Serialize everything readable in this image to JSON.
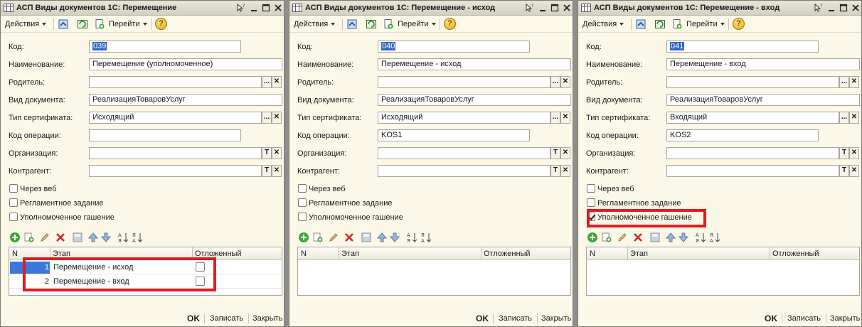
{
  "windows": [
    {
      "title": "АСП Виды документов 1С: Перемещение",
      "toolbar": {
        "actions": "Действия",
        "goto": "Перейти",
        "help": "?"
      },
      "fields": {
        "code_label": "Код:",
        "code_value": "039",
        "name_label": "Наименование:",
        "name_value": "Перемещение (уполномоченное)",
        "parent_label": "Родитель:",
        "parent_value": "",
        "doc_type_label": "Вид документа:",
        "doc_type_value": "РеализацияТоваровУслуг",
        "cert_type_label": "Тип сертификата:",
        "cert_type_value": "Исходящий",
        "op_code_label": "Код операции:",
        "op_code_value": "",
        "org_label": "Организация:",
        "org_value": "",
        "contractor_label": "Контрагент:",
        "contractor_value": ""
      },
      "checkboxes": [
        {
          "label": "Через веб",
          "checked": false
        },
        {
          "label": "Регламентное задание",
          "checked": false
        },
        {
          "label": "Уполномоченное гашение",
          "checked": false
        }
      ],
      "grid": {
        "columns": [
          "N",
          "Этап",
          "Отложенный"
        ],
        "rows": [
          {
            "n": "1",
            "stage": "Перемещение - исход",
            "deferred": false
          },
          {
            "n": "2",
            "stage": "Перемещение - вход",
            "deferred": false
          }
        ]
      },
      "footer": {
        "ok": "OK",
        "save": "Записать",
        "close": "Закрыть"
      }
    },
    {
      "title": "АСП Виды документов 1С: Перемещение - исход",
      "toolbar": {
        "actions": "Действия",
        "goto": "Перейти",
        "help": "?"
      },
      "fields": {
        "code_label": "Код:",
        "code_value": "040",
        "name_label": "Наименование:",
        "name_value": "Перемещение - исход",
        "parent_label": "Родитель:",
        "parent_value": "",
        "doc_type_label": "Вид документа:",
        "doc_type_value": "РеализацияТоваровУслуг",
        "cert_type_label": "Тип сертификата:",
        "cert_type_value": "Исходящий",
        "op_code_label": "Код операции:",
        "op_code_value": "KOS1",
        "org_label": "Организация:",
        "org_value": "",
        "contractor_label": "Контрагент:",
        "contractor_value": ""
      },
      "checkboxes": [
        {
          "label": "Через веб",
          "checked": false
        },
        {
          "label": "Регламентное задание",
          "checked": false
        },
        {
          "label": "Уполномоченное гашение",
          "checked": false
        }
      ],
      "grid": {
        "columns": [
          "N",
          "Этап",
          "Отложенный"
        ],
        "rows": []
      },
      "footer": {
        "ok": "OK",
        "save": "Записать",
        "close": "Закрыть"
      }
    },
    {
      "title": "АСП Виды документов 1С: Перемещение - вход",
      "toolbar": {
        "actions": "Действия",
        "goto": "Перейти",
        "help": "?"
      },
      "fields": {
        "code_label": "Код:",
        "code_value": "041",
        "name_label": "Наименование:",
        "name_value": "Перемещение - вход",
        "parent_label": "Родитель:",
        "parent_value": "",
        "doc_type_label": "Вид документа:",
        "doc_type_value": "РеализацияТоваровУслуг",
        "cert_type_label": "Тип сертификата:",
        "cert_type_value": "Входящий",
        "op_code_label": "Код операции:",
        "op_code_value": "KOS2",
        "org_label": "Организация:",
        "org_value": "",
        "contractor_label": "Контрагент:",
        "contractor_value": ""
      },
      "checkboxes": [
        {
          "label": "Через веб",
          "checked": false
        },
        {
          "label": "Регламентное задание",
          "checked": false
        },
        {
          "label": "Уполномоченное гашение",
          "checked": true
        }
      ],
      "grid": {
        "columns": [
          "N",
          "Этап",
          "Отложенный"
        ],
        "rows": []
      },
      "footer": {
        "ok": "OK",
        "save": "Записать",
        "close": "Закрыть"
      }
    }
  ],
  "colors": {
    "highlight": "#e01b24",
    "selection": "#3167c8",
    "window_bg": "#fbf8e8"
  }
}
